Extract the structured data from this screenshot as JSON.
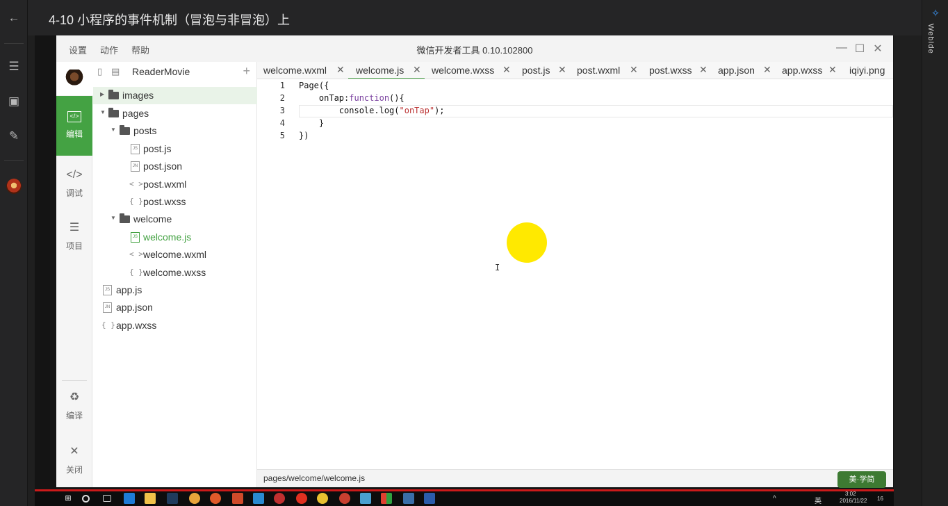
{
  "lesson_title": "4-10 小程序的事件机制（冒泡与非冒泡）上",
  "webide": {
    "label": "WebIde"
  },
  "menu": {
    "settings": "设置",
    "action": "动作",
    "help": "帮助"
  },
  "window_title": "微信开发者工具 0.10.102800",
  "sidebar": {
    "edit": "编辑",
    "debug": "调试",
    "project": "项目",
    "compile": "编译",
    "close": "关闭"
  },
  "tree": {
    "project_name": "ReaderMovie",
    "nodes": [
      {
        "label": "images"
      },
      {
        "label": "pages"
      },
      {
        "label": "posts"
      },
      {
        "label": "post.js",
        "icon": "JS"
      },
      {
        "label": "post.json",
        "icon": "JN"
      },
      {
        "label": "post.wxml",
        "icon": "< >"
      },
      {
        "label": "post.wxss",
        "icon": "{ }"
      },
      {
        "label": "welcome"
      },
      {
        "label": "welcome.js",
        "icon": "JS"
      },
      {
        "label": "welcome.wxml",
        "icon": "< >"
      },
      {
        "label": "welcome.wxss",
        "icon": "{ }"
      },
      {
        "label": "app.js",
        "icon": "JS"
      },
      {
        "label": "app.json",
        "icon": "JN"
      },
      {
        "label": "app.wxss",
        "icon": "{ }"
      }
    ]
  },
  "tabs": [
    {
      "label": "welcome.wxml"
    },
    {
      "label": "welcome.js"
    },
    {
      "label": "welcome.wxss"
    },
    {
      "label": "post.js"
    },
    {
      "label": "post.wxml"
    },
    {
      "label": "post.wxss"
    },
    {
      "label": "app.json"
    },
    {
      "label": "app.wxss"
    },
    {
      "label": "iqiyi.png"
    }
  ],
  "code": {
    "line_numbers": [
      "1",
      "2",
      "3",
      "4",
      "5"
    ],
    "lines": {
      "l1": "Page({",
      "l2_name": "    onTap:",
      "l2_kw": "function",
      "l2_rest": "(){",
      "l3_a": "        console.log(",
      "l3_str": "\"onTap\"",
      "l3_b": ");",
      "l4": "    }",
      "l5": "})"
    }
  },
  "status_path": "pages/welcome/welcome.js",
  "badge": "美·学简",
  "tray": {
    "time": "3:02",
    "date": "2016/11/22",
    "lang": "英",
    "notify": "16"
  },
  "colors": {
    "accent": "#44a243",
    "highlight_dot": "#ffe900",
    "taskbar_border": "#cc1a1a"
  }
}
